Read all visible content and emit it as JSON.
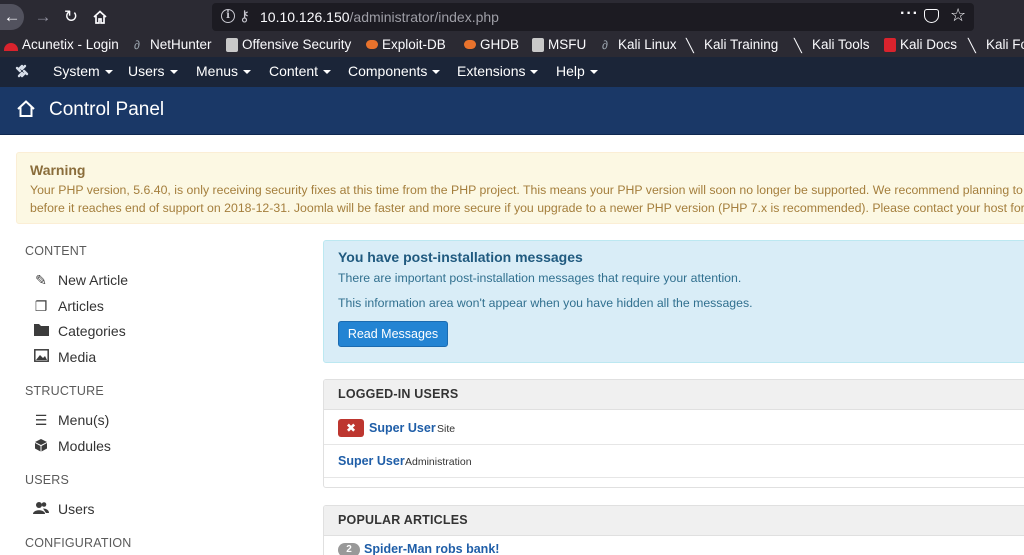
{
  "browser": {
    "url_host": "10.10.126.150",
    "url_path": "/administrator/index.php",
    "bookmarks": [
      {
        "label": "Acunetix - Login",
        "icon": "acunetix-icon",
        "color": "#d9232d"
      },
      {
        "label": "NetHunter",
        "icon": "nethunter-icon",
        "color": "#9aa3ad"
      },
      {
        "label": "Offensive Security",
        "icon": "offsec-icon",
        "color": "#c9c9c9"
      },
      {
        "label": "Exploit-DB",
        "icon": "exploitdb-icon",
        "color": "#e8722c"
      },
      {
        "label": "GHDB",
        "icon": "ghdb-icon",
        "color": "#e8722c"
      },
      {
        "label": "MSFU",
        "icon": "msfu-icon",
        "color": "#c9c9c9"
      },
      {
        "label": "Kali Linux",
        "icon": "kali-icon",
        "color": "#9aa3ad"
      },
      {
        "label": "Kali Training",
        "icon": "kali-icon",
        "color": "#9aa3ad"
      },
      {
        "label": "Kali Tools",
        "icon": "kali-icon",
        "color": "#9aa3ad"
      },
      {
        "label": "Kali Docs",
        "icon": "kali-docs-icon",
        "color": "#d9232d"
      },
      {
        "label": "Kali Fo",
        "icon": "kali-icon",
        "color": "#9aa3ad"
      }
    ]
  },
  "menu": {
    "items": [
      "System",
      "Users",
      "Menus",
      "Content",
      "Components",
      "Extensions",
      "Help"
    ]
  },
  "header": {
    "title": "Control Panel"
  },
  "warning": {
    "title": "Warning",
    "line1": "Your PHP version, 5.6.40, is only receiving security fixes at this time from the PHP project. This means your PHP version will soon no longer be supported. We recommend planning to upgr",
    "line2": "before it reaches end of support on 2018-12-31. Joomla will be faster and more secure if you upgrade to a newer PHP version (PHP 7.x is recommended). Please contact your host for upgra"
  },
  "sidebar": {
    "content_heading": "CONTENT",
    "content_items": [
      "New Article",
      "Articles",
      "Categories",
      "Media"
    ],
    "structure_heading": "STRUCTURE",
    "structure_items": [
      "Menu(s)",
      "Modules"
    ],
    "users_heading": "USERS",
    "users_items": [
      "Users"
    ],
    "configuration_heading": "CONFIGURATION"
  },
  "postinstall": {
    "title": "You have post-installation messages",
    "text1": "There are important post-installation messages that require your attention.",
    "text2": "This information area won't appear when you have hidden all the messages.",
    "button": "Read Messages"
  },
  "logged_in": {
    "title": "LOGGED-IN USERS",
    "rows": [
      {
        "name": "Super User",
        "context": "Site",
        "logout": "✖"
      },
      {
        "name": "Super User",
        "context": "Administration"
      }
    ]
  },
  "popular": {
    "title": "POPULAR ARTICLES",
    "first_hits": "2",
    "first_title": "Spider-Man robs bank!"
  }
}
